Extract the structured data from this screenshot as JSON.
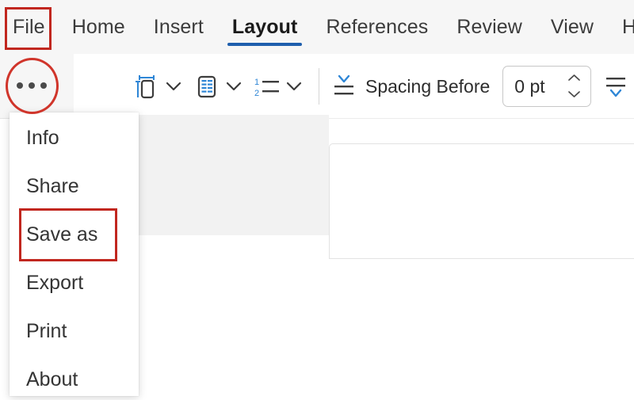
{
  "window": {
    "app": "word-like-document-editor"
  },
  "tabs": {
    "items": [
      {
        "label": "File",
        "active": false
      },
      {
        "label": "Home",
        "active": false
      },
      {
        "label": "Insert",
        "active": false
      },
      {
        "label": "Layout",
        "active": true
      },
      {
        "label": "References",
        "active": false
      },
      {
        "label": "Review",
        "active": false
      },
      {
        "label": "View",
        "active": false
      },
      {
        "label": "Help",
        "active": false
      }
    ]
  },
  "ribbon": {
    "overflow_button": "•••",
    "groups": [
      {
        "icon": "page-size-icon",
        "has_chevron": true
      },
      {
        "icon": "columns-icon",
        "has_chevron": true
      },
      {
        "icon": "line-numbers-icon",
        "has_chevron": true
      }
    ],
    "spacing_before": {
      "icon": "spacing-before-icon",
      "label": "Spacing Before",
      "value": "0 pt"
    },
    "spacing_after": {
      "icon": "spacing-after-icon"
    }
  },
  "file_menu": {
    "open": true,
    "items": [
      {
        "label": "Info",
        "highlighted": false
      },
      {
        "label": "Share",
        "highlighted": false
      },
      {
        "label": "Save as",
        "highlighted": true
      },
      {
        "label": "Export",
        "highlighted": false
      },
      {
        "label": "Print",
        "highlighted": false
      },
      {
        "label": "About",
        "highlighted": false
      }
    ]
  },
  "annotations": {
    "file_tab_box": {
      "target": "File tab"
    },
    "overflow_circle": {
      "target": "Ribbon overflow button"
    },
    "save_as_box": {
      "target": "Save as menu item"
    }
  },
  "colors": {
    "accent_blue": "#1f5fad",
    "annotation_red": "#c1271f",
    "chrome_gray": "#f6f6f6",
    "panel_gray": "#f2f2f2"
  }
}
